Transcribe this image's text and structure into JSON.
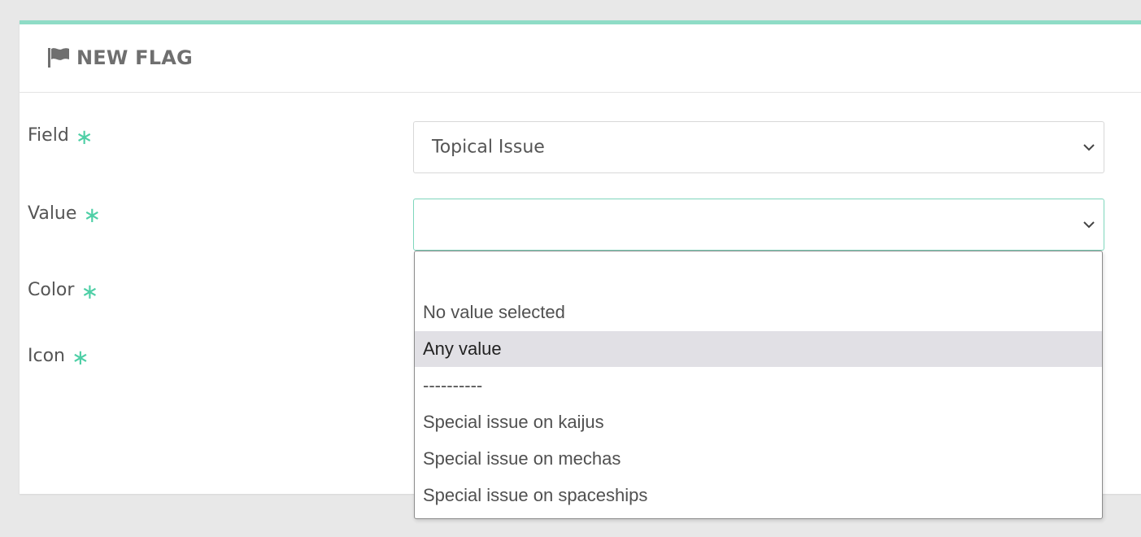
{
  "panel": {
    "title": "NEW FLAG",
    "title_icon": "flag-icon",
    "accent_color": "#8fdcc6"
  },
  "form": {
    "required_marker": "∗",
    "required_color": "#4ecfa6",
    "field": {
      "label": "Field",
      "selected": "Topical Issue"
    },
    "value": {
      "label": "Value",
      "selected": ""
    },
    "color": {
      "label": "Color"
    },
    "icon": {
      "label": "Icon"
    }
  },
  "value_dropdown": {
    "options": [
      {
        "label": "",
        "highlighted": false
      },
      {
        "label": "No value selected",
        "highlighted": false
      },
      {
        "label": "Any value",
        "highlighted": true
      },
      {
        "label": "----------",
        "highlighted": false
      },
      {
        "label": "Special issue on kaijus",
        "highlighted": false
      },
      {
        "label": "Special issue on mechas",
        "highlighted": false
      },
      {
        "label": "Special issue on spaceships",
        "highlighted": false
      }
    ]
  }
}
